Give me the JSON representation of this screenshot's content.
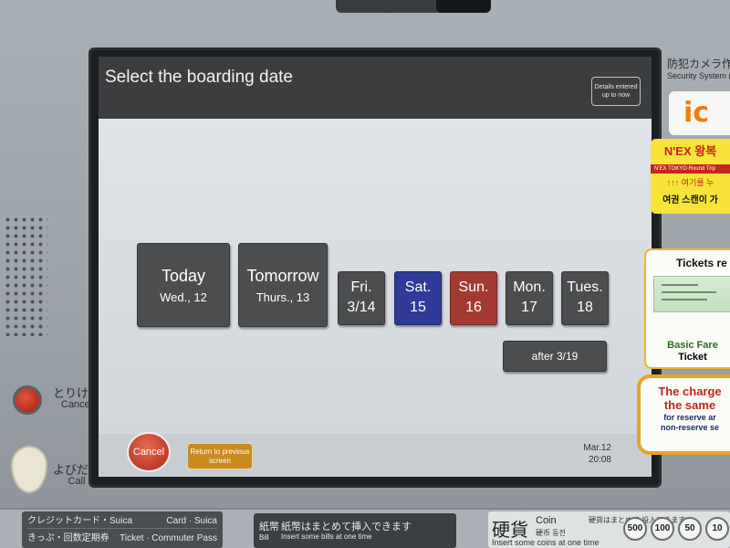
{
  "screen": {
    "title": "Select the boarding date",
    "details_button": "Details entered up to now",
    "dates": [
      {
        "day": "Today",
        "date": "Wed., 12"
      },
      {
        "day": "Tomorrow",
        "date": "Thurs., 13"
      },
      {
        "day": "Fri.",
        "date": "3/14"
      },
      {
        "day": "Sat.",
        "date": "15"
      },
      {
        "day": "Sun.",
        "date": "16"
      },
      {
        "day": "Mon.",
        "date": "17"
      },
      {
        "day": "Tues.",
        "date": "18"
      }
    ],
    "after_button": "after 3/19",
    "cancel_button": "Cancel",
    "return_button": "Return to previous screen",
    "clock_date": "Mar.12",
    "clock_time": "20:08",
    "colors": {
      "weekday": "#4c4d4f",
      "saturday": "#2f3b96",
      "sunday": "#a23a32",
      "return": "#c98a22",
      "cancel": "#b22618"
    }
  },
  "machine": {
    "cancel_jp": "とりけし",
    "cancel_en": "Cancel",
    "call_jp": "よびだし",
    "call_en": "Call",
    "camera_jp": "防犯カメラ作",
    "camera_en": "Security System (i",
    "ic_logo": "ic",
    "nex_top": "N'EX 왕복",
    "nex_band": "N'EX TOKYO Round Trip",
    "nex_arrows": "↑↑↑ 여기를 누",
    "nex_bottom": "여권 스캔이 가",
    "tickets_title": "Tickets re",
    "tickets_caption_1": "Basic Fare",
    "tickets_caption_2": "Ticket",
    "charge_1": "The charge",
    "charge_2": "the same",
    "charge_3": "for reserve ar",
    "charge_4": "non-reserve se",
    "card_jp": "クレジットカード・Suica",
    "card_en": "Card · Suica",
    "commuter_jp": "きっぷ・回数定期券",
    "commuter_en": "Ticket · Commuter Pass",
    "bill_kanji": "紙幣",
    "bill_en_label": "Bill",
    "bill_jp": "紙幣はまとめて挿入できます",
    "bill_en": "Insert some bills at one time",
    "coin_kanji": "硬貨",
    "coin_en": "Coin",
    "coin_jp2": "硬币 동전",
    "coin_jp3": "硬貨はまとめて 投入できます",
    "coin_insert": "Insert some coins at one time",
    "coin_values": [
      "500",
      "100",
      "50",
      "10"
    ]
  }
}
